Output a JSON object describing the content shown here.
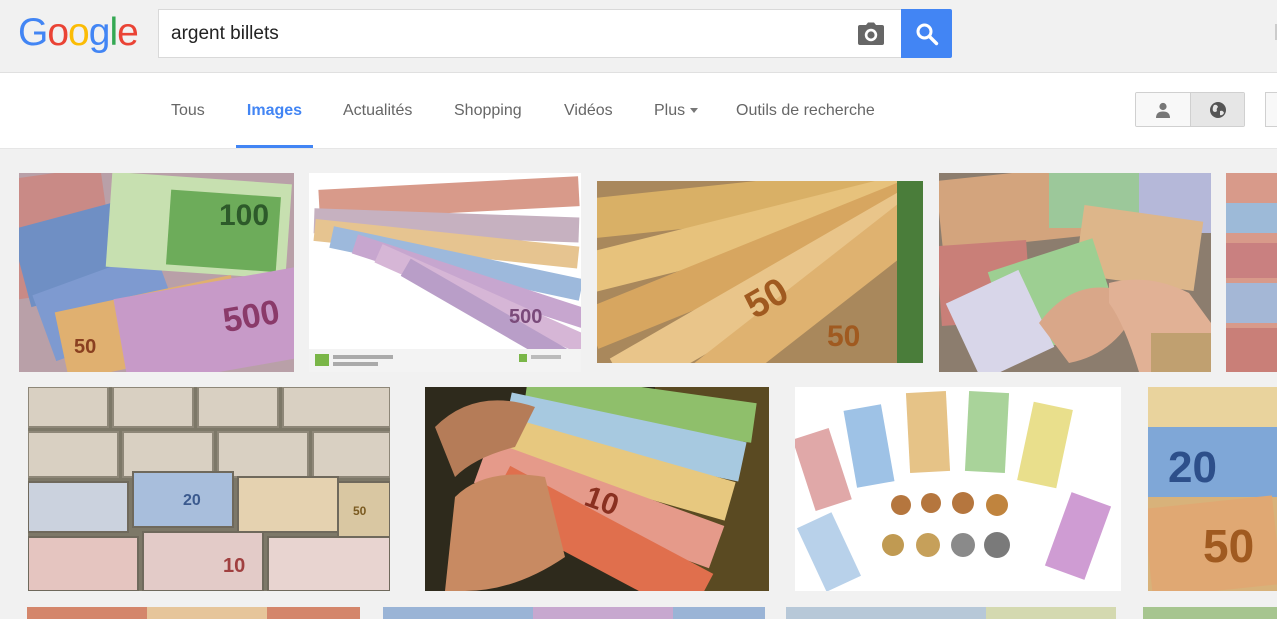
{
  "logo": {
    "text": "Google",
    "letters": [
      "G",
      "o",
      "o",
      "g",
      "l",
      "e"
    ],
    "colors": [
      "#4285f4",
      "#ea4335",
      "#fbbc05",
      "#4285f4",
      "#34a853",
      "#ea4335"
    ]
  },
  "search": {
    "query": "argent billets",
    "camera_icon": "camera-icon",
    "button_icon": "search-icon",
    "button_color": "#4285f4"
  },
  "tabs": [
    {
      "label": "Tous",
      "active": false
    },
    {
      "label": "Images",
      "active": true
    },
    {
      "label": "Actualités",
      "active": false
    },
    {
      "label": "Shopping",
      "active": false
    },
    {
      "label": "Vidéos",
      "active": false
    },
    {
      "label": "Plus",
      "active": false,
      "dropdown": true
    },
    {
      "label": "Outils de recherche",
      "active": false
    }
  ],
  "view_toggle": [
    {
      "icon": "person-icon",
      "selected": false
    },
    {
      "icon": "globe-icon",
      "selected": true
    }
  ],
  "accent_color": "#4285f4",
  "image_results": [
    {
      "subject": "euro banknotes 100 20 500 spread"
    },
    {
      "subject": "fan of euro banknotes stock photo"
    },
    {
      "subject": "fan of 50 euro banknotes"
    },
    {
      "subject": "hands counting euro banknotes"
    },
    {
      "subject": "euro banknotes (partial)"
    },
    {
      "subject": "stacks of bundled euro banknotes"
    },
    {
      "subject": "hand holding bundle of euro banknotes"
    },
    {
      "subject": "euro banknotes and coins arranged in an arc"
    },
    {
      "subject": "close-up of 20 and 50 euro banknotes"
    }
  ]
}
